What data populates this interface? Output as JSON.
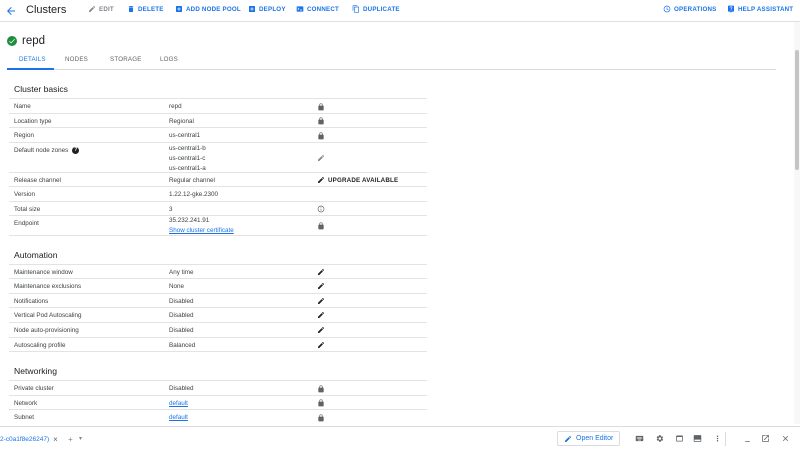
{
  "header": {
    "title": "Clusters",
    "actions": {
      "edit": "EDIT",
      "delete": "DELETE",
      "add_node_pool": "ADD NODE POOL",
      "deploy": "DEPLOY",
      "connect": "CONNECT",
      "duplicate": "DUPLICATE",
      "operations": "OPERATIONS",
      "help_assistant": "HELP ASSISTANT"
    }
  },
  "cluster": {
    "name": "repd",
    "status_icon": "check-circle-icon",
    "status_color": "#1e8e3e"
  },
  "tabs": [
    "DETAILS",
    "NODES",
    "STORAGE",
    "LOGS"
  ],
  "active_tab": "DETAILS",
  "cluster_basics": {
    "title": "Cluster basics",
    "rows": [
      {
        "label": "Name",
        "value": "repd",
        "icon": "lock-icon"
      },
      {
        "label": "Location type",
        "value": "Regional",
        "icon": "lock-icon"
      },
      {
        "label": "Region",
        "value": "us-central1",
        "icon": "lock-icon"
      },
      {
        "label": "Default node zones",
        "values": [
          "us-central1-b",
          "us-central1-c",
          "us-central1-a"
        ],
        "icon": "pencil-icon",
        "help_icon": "help-icon"
      },
      {
        "label": "Release channel",
        "value": "Regular channel",
        "icon": "pencil-icon",
        "action": "UPGRADE AVAILABLE"
      },
      {
        "label": "Version",
        "value": "1.22.12-gke.2300"
      },
      {
        "label": "Total size",
        "value": "3",
        "icon": "info-icon"
      },
      {
        "label": "Endpoint",
        "value": "35.232.241.91",
        "link": "Show cluster certificate",
        "icon": "lock-icon"
      }
    ]
  },
  "automation": {
    "title": "Automation",
    "rows": [
      {
        "label": "Maintenance window",
        "value": "Any time",
        "icon": "pencil-icon"
      },
      {
        "label": "Maintenance exclusions",
        "value": "None",
        "icon": "pencil-icon"
      },
      {
        "label": "Notifications",
        "value": "Disabled",
        "icon": "pencil-icon"
      },
      {
        "label": "Vertical Pod Autoscaling",
        "value": "Disabled",
        "icon": "pencil-icon"
      },
      {
        "label": "Node auto-provisioning",
        "value": "Disabled",
        "icon": "pencil-icon"
      },
      {
        "label": "Autoscaling profile",
        "value": "Balanced",
        "icon": "pencil-icon"
      }
    ]
  },
  "networking": {
    "title": "Networking",
    "rows": [
      {
        "label": "Private cluster",
        "value": "Disabled",
        "icon": "lock-icon"
      },
      {
        "label": "Network",
        "value": "default",
        "is_link": true,
        "icon": "lock-icon"
      },
      {
        "label": "Subnet",
        "value": "default",
        "is_link": true,
        "icon": "lock-icon"
      }
    ]
  },
  "terminal": {
    "tab_label": "2-c0a1f8e26247)",
    "close_symbol": "×",
    "add_symbol": "+",
    "more_symbol": "▾",
    "open_editor": "Open Editor"
  },
  "colors": {
    "accent": "#1a73e8",
    "text": "#202124",
    "muted": "#5f6368",
    "success": "#1e8e3e"
  }
}
